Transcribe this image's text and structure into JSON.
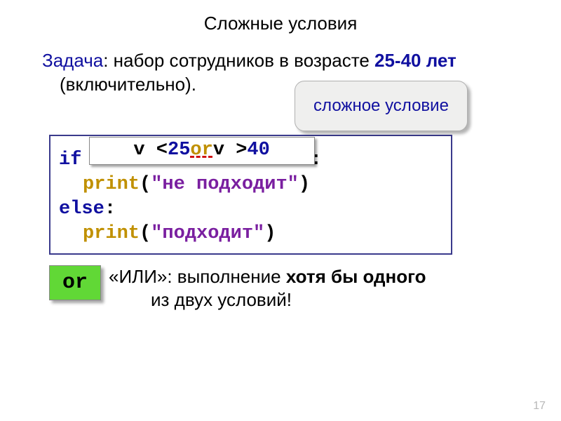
{
  "title": "Сложные условия",
  "task": {
    "label": "Задача",
    "before_age": ": набор сотрудников в возрасте ",
    "age": "25-40 лет",
    "after_age": " (включительно)."
  },
  "callout": "сложное условие",
  "code": {
    "if_kw": "if",
    "cond": {
      "p1": "v < ",
      "n1": "25",
      "sp1": " ",
      "op": "or",
      "sp2": " ",
      "p2": "v > ",
      "n2": "40"
    },
    "colon1": ":",
    "print_fn": "print",
    "str_ne": "\"не подходит\"",
    "else_kw": "else",
    "colon2": ":",
    "str_ok": "\"подходит\""
  },
  "or_badge": "or",
  "or_text": {
    "p1": "«ИЛИ»: выполнение ",
    "b1": "хотя бы одного",
    "p2": "из двух условий!"
  },
  "pagenum": "17"
}
